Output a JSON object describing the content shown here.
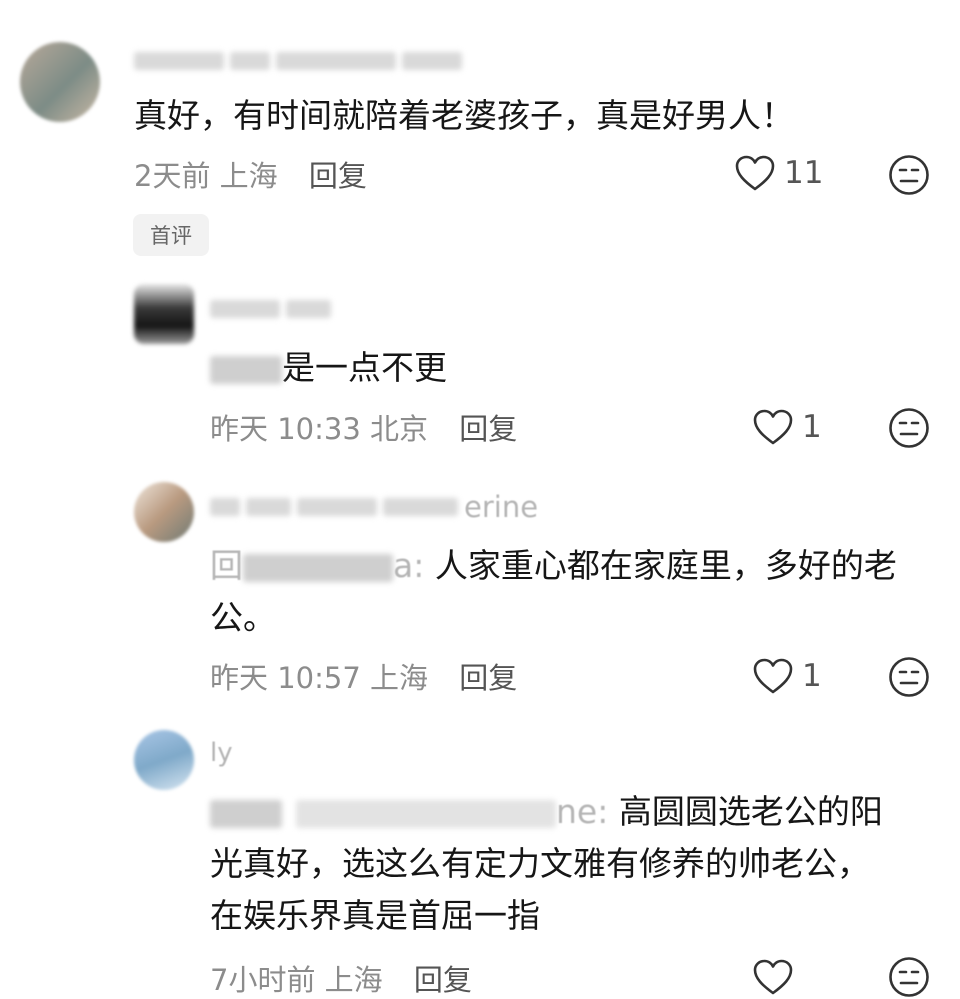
{
  "comments": [
    {
      "text": "真好，有时间就陪着老婆孩子，真是好男人！",
      "time": "2天前",
      "location": "上海",
      "reply_label": "回复",
      "likes": "11",
      "tag": "首评"
    },
    {
      "text": "是一点不更",
      "time": "昨天 10:33",
      "location": "北京",
      "reply_label": "回复",
      "likes": "1"
    },
    {
      "name_suffix": "erine",
      "reply_prefix": "回",
      "reply_to_suffix": "a:",
      "text_line1": "人家重心都在家庭里，多好的老",
      "text_line2": "公。",
      "time": "昨天 10:57",
      "location": "上海",
      "reply_label": "回复",
      "likes": "1"
    },
    {
      "name_fragment": "ly",
      "reply_to_suffix": "ne:",
      "text_line1": "高圆圆选老公的阳",
      "text_line2": "光真好，选这么有定力文雅有修养的帅老公，",
      "text_line3": "在娱乐界真是首屈一指",
      "time": "7小时前",
      "location": "上海",
      "reply_label": "回复",
      "likes": ""
    }
  ],
  "icons": {
    "like": "heart-outline-icon",
    "emoji": "meh-face-icon"
  },
  "colors": {
    "text": "#161616",
    "meta": "#8c8c8c",
    "icon": "#333333"
  }
}
